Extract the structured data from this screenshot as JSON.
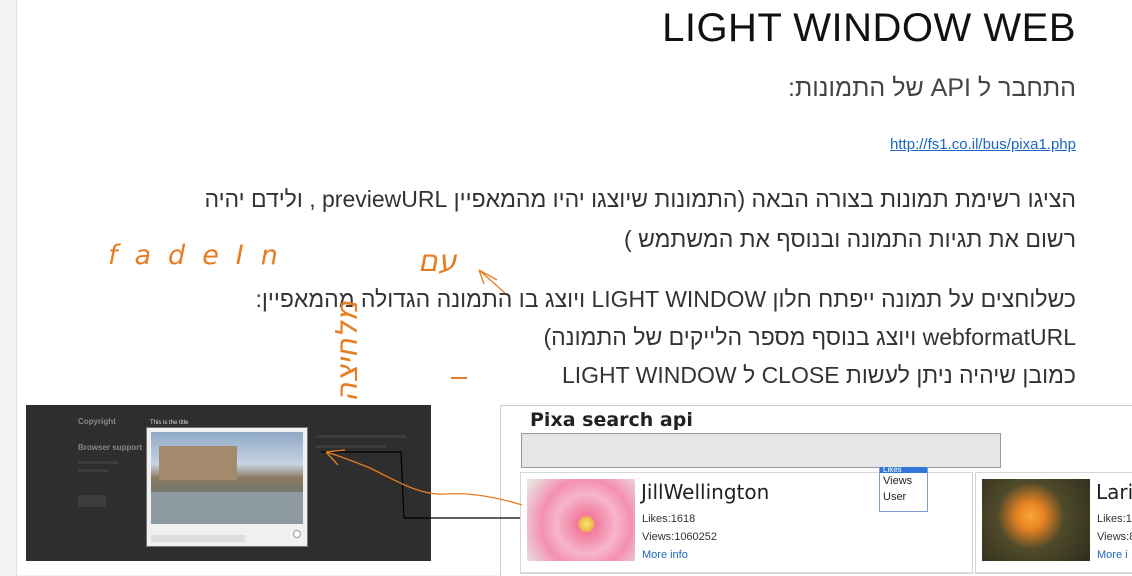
{
  "document": {
    "title": "LIGHT WINDOW WEB",
    "subtitle": "התחבר ל API של התמונות:",
    "link": "http://fs1.co.il/bus/pixa1.php",
    "para1_line1": "הציגו רשימת תמונות בצורה הבאה (התמונות שיוצגו יהיו מהמאפיין previewURL , ולידם יהיה",
    "para1_line2": "רשום את תגיות התמונה ובנוסף את המשתמש )",
    "para2_line1": "כשלוחצים על תמונה ייפתח חלון LIGHT WINDOW ויוצג בו התמונה הגדולה מהמאפיין:",
    "para2_line2": "webformatURL ויוצג בנוסף מספר הלייקים של התמונה)",
    "para2_line3": "כמובן שיהיה ניתן לעשות CLOSE ל LIGHT WINDOW"
  },
  "handwriting": {
    "fade_in": "fadeIn",
    "im": "עם",
    "noted": "מלחיצה"
  },
  "lightbox_preview": {
    "caption": "This is the title",
    "side_title": "Copyright",
    "side_subtitle": "Browser support"
  },
  "pixa": {
    "title": "Pixa search api",
    "search_value": "",
    "select_options": [
      "Likes",
      "Views",
      "User"
    ],
    "results": [
      {
        "user": "JillWellington",
        "likes": "Likes:1618",
        "views": "Views:1060252",
        "more": "More info"
      },
      {
        "user": "Lari",
        "likes": "Likes:1",
        "views": "Views:8",
        "more": "More i"
      }
    ]
  },
  "colors": {
    "annotation": "#e67d22",
    "link": "#1a66c0",
    "spellcheck": "#ee3333"
  }
}
